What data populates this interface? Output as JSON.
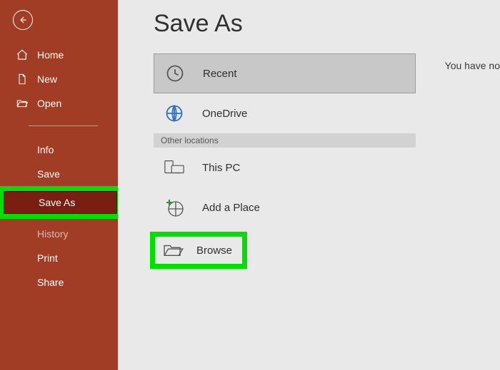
{
  "sidebar": {
    "home": "Home",
    "new": "New",
    "open": "Open",
    "info": "Info",
    "save": "Save",
    "save_as": "Save As",
    "history": "History",
    "print": "Print",
    "share": "Share"
  },
  "page": {
    "title": "Save As",
    "right_truncated": "You have no"
  },
  "locations": {
    "recent": "Recent",
    "onedrive": "OneDrive",
    "section_other": "Other locations",
    "this_pc": "This PC",
    "add_place": "Add a Place",
    "browse": "Browse"
  }
}
